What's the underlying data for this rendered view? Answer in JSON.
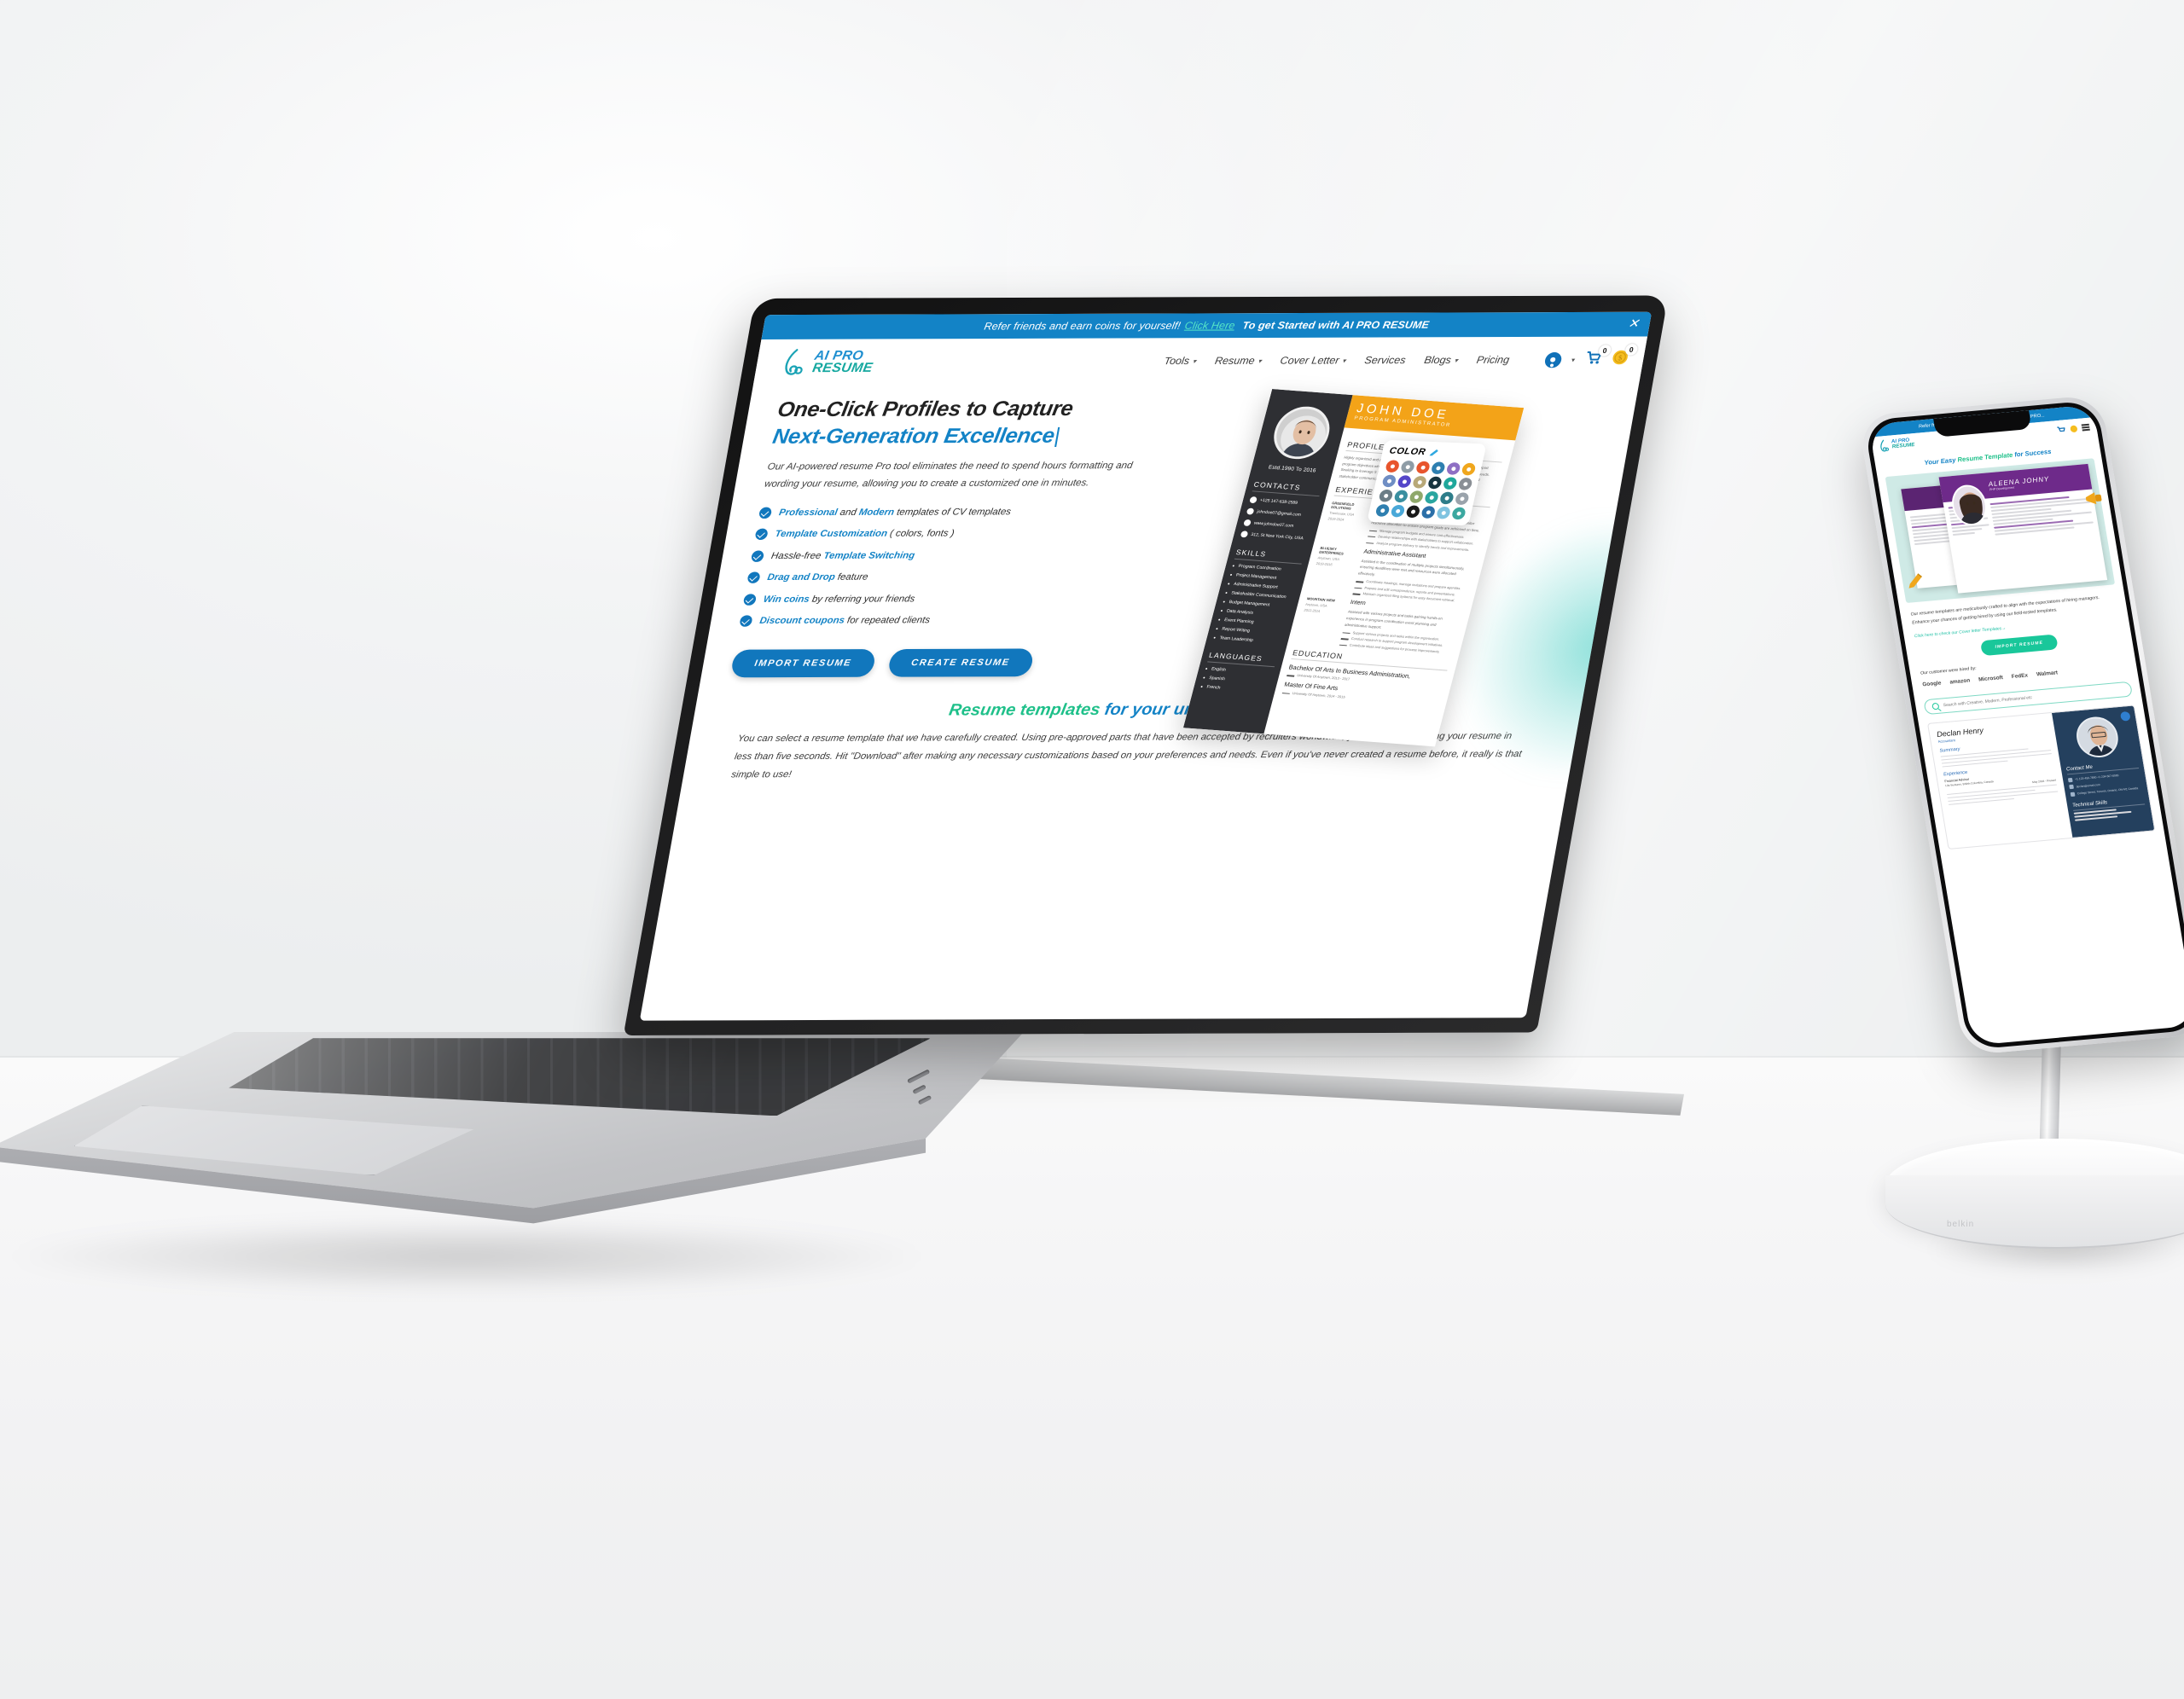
{
  "scene": {
    "devices": [
      "laptop",
      "phone"
    ],
    "stand_brand": "belkin"
  },
  "laptop": {
    "banner": {
      "text_1": "Refer friends and earn coins for yourself!",
      "link": "Click Here",
      "text_2": "To get Started with AI PRO RESUME",
      "close_icon": "✕"
    },
    "nav": {
      "logo_line1": "AI PRO",
      "logo_line2": "RESUME",
      "items": [
        {
          "label": "Tools",
          "has_caret": true
        },
        {
          "label": "Resume",
          "has_caret": true
        },
        {
          "label": "Cover Letter",
          "has_caret": true
        },
        {
          "label": "Services",
          "has_caret": false
        },
        {
          "label": "Blogs",
          "has_caret": true
        },
        {
          "label": "Pricing",
          "has_caret": false
        }
      ],
      "cart_count": "0",
      "coin_count": "0",
      "caret": "▾"
    },
    "hero": {
      "title_line1": "One-Click Profiles to Capture",
      "title_line2": "Next-Generation Excellence",
      "cursor": "|",
      "subtitle": "Our AI-powered resume Pro tool eliminates the need to spend hours formatting and wording your resume, allowing you to create a customized one in minutes.",
      "features": [
        {
          "bold_1": "Professional",
          "mid": " and ",
          "bold_2": "Modern",
          "rest": " templates of CV templates"
        },
        {
          "bold_1": "Template Customization",
          "mid": "",
          "bold_2": "",
          "rest": " ( colors, fonts )"
        },
        {
          "bold_1": "",
          "mid": "Hassle-free ",
          "bold_2": "Template Switching",
          "rest": ""
        },
        {
          "bold_1": "Drag and Drop",
          "mid": "",
          "bold_2": "",
          "rest": " feature"
        },
        {
          "bold_1": "Win coins",
          "mid": "",
          "bold_2": "",
          "rest": " by referring your friends"
        },
        {
          "bold_1": "Discount coupons",
          "mid": "",
          "bold_2": "",
          "rest": " for repeated clients"
        }
      ],
      "btn_import": "IMPORT RESUME",
      "btn_create": "CREATE RESUME"
    },
    "resume_preview": {
      "name": "JOHN DOE",
      "role": "PROGRAM ADMINISTRATOR",
      "estd": "Estd.1990 To 2016",
      "contacts_heading": "CONTACTS",
      "contacts": [
        "+125 147-638-2589",
        "johndoe07@gmail.com",
        "www.johndoe07.com",
        "312, St New York City, USA"
      ],
      "skills_heading": "SKILLS",
      "skills": [
        "Program Coordination",
        "Project Management",
        "Administrative Support",
        "Stakeholder Communication",
        "Budget Management",
        "Data Analysis",
        "Event Planning",
        "Report Writing",
        "Team Leadership"
      ],
      "languages_heading": "LANGUAGES",
      "languages": [
        "English",
        "Spanish",
        "French"
      ],
      "profile_heading": "PROFILE",
      "profile_text": "Highly organized and detail-oriented Program Administrator with proven ability to support program objectives while coordinating diverse administrative tasks and stakeholder needs. Seeking to leverage 5 years of experience in program planning, budget oversight and stakeholder communication to contribute to the organization.",
      "experience_heading": "EXPERIENCE",
      "experience": [
        {
          "company": "GREENFIELD SOLUTIONS",
          "location": "Trenhouse, USA",
          "dates": "2019-2024",
          "title": "Program Administrator",
          "summary": "Coordinate program activities, manage schedules and monitor resource allocation to ensure program goals are achieved on time.",
          "bullets": [
            "Manage program budgets and ensure cost-effectiveness.",
            "Develop relationships with stakeholders to support collaboration.",
            "Analyze program delivery to identify trends and improvements."
          ]
        },
        {
          "company": "BLUESKY ENTERPRISES",
          "location": "Anytown, USA",
          "dates": "2019-2016",
          "title": "Administrative Assistant",
          "summary": "Assisted in the coordination of multiple projects simultaneously, ensuring deadlines were met and resources were allocated effectively.",
          "bullets": [
            "Coordinate meetings, manage invitations and prepare agendas.",
            "Prepare and edit correspondence, reports and presentations.",
            "Maintain organized filing systems for easy document retrieval."
          ]
        },
        {
          "company": "MOUNTAIN VIEW",
          "location": "Anytown, USA",
          "dates": "2012-2014",
          "title": "Intern",
          "summary": "Assisted with various projects and tasks gaining hands-on experience in program coordination event planning and administrative support.",
          "bullets": [
            "Support various projects and tasks within the organization.",
            "Conduct research to support program development initiatives.",
            "Contribute ideas and suggestions for process improvements."
          ]
        }
      ],
      "education_heading": "EDUCATION",
      "education": [
        {
          "degree": "Bachelor Of Arts In Business Administration,",
          "school": "University Of Anytown,  2013 - 2017"
        },
        {
          "degree": "Master Of Fine Arts",
          "school": "University Of Anytown,  2014 - 2015"
        }
      ]
    },
    "color_picker": {
      "heading": "COLOR",
      "icon": "pencil-icon",
      "swatches": [
        "#e8552d",
        "#8e9ca6",
        "#e8552d",
        "#2e7fb0",
        "#8e6fc4",
        "#f0a71d",
        "#6f8ec4",
        "#5446c9",
        "#b8a878",
        "#17343f",
        "#1fa79b",
        "#8a8f95",
        "#6b7d86",
        "#3a8fa0",
        "#8fa86b",
        "#2aa6a0",
        "#2e7d8a",
        "#9aa3ab",
        "#2e7fb0",
        "#4aa8d8",
        "#1a1a1a",
        "#2b6fa8",
        "#7fc3e0",
        "#3ba8a0"
      ]
    },
    "section2": {
      "heading_green": "Resume templates",
      "heading_blue": " for your unique career path",
      "paragraph": "You can select a resume template that we have carefully created. Using pre-approved parts that have been accepted by recruiters worldwide, you can begin building your resume in less than five seconds. Hit \"Download\" after making any necessary customizations based on your preferences and needs. Even if you've never created a resume before, it really is that simple to use!"
    }
  },
  "phone": {
    "banner": "Refer friends and earn coins... To get Started with AI PRO...",
    "logo_line1": "AI PRO",
    "logo_line2": "RESUME",
    "title_blue_1": "Your Easy ",
    "title_green": "Resume Template",
    "title_blue_2": " for Success",
    "card_name": "ALEENA JOHNY",
    "card_role": "PHP Development",
    "body": "Our resume templates are meticulously crafted to align with the expectations of hiring managers. Enhance your chances of getting hired by using our field-tested templates.",
    "link_prefix": "Click here to check our ",
    "link_text": "Cover letter Templates",
    "link_arrow": "→",
    "btn_import": "IMPORT RESUME",
    "hired_label": "Our customer were hired by:",
    "brands": [
      "Google",
      "amazon",
      "Microsoft",
      "FedEx",
      "Walmart"
    ],
    "search_placeholder": "Search with Creative, Modern, Professional etc",
    "declan": {
      "name": "Declan Henry",
      "role": "Accountant",
      "summary_heading": "Summary",
      "experience_heading": "Experience",
      "job_title": "Financial Advisor",
      "job_company": "Lila Ventures, British Columbia, Canada",
      "job_dates": "May 2018 - Present",
      "contact_heading": "Contact Me",
      "contacts": [
        "+1 123-456-7890  +1 234-567-8900",
        "declan@email.com",
        "College Street, Toronto, Ontario, ON-M1 Canada"
      ],
      "skills_heading": "Technical Skills"
    }
  }
}
